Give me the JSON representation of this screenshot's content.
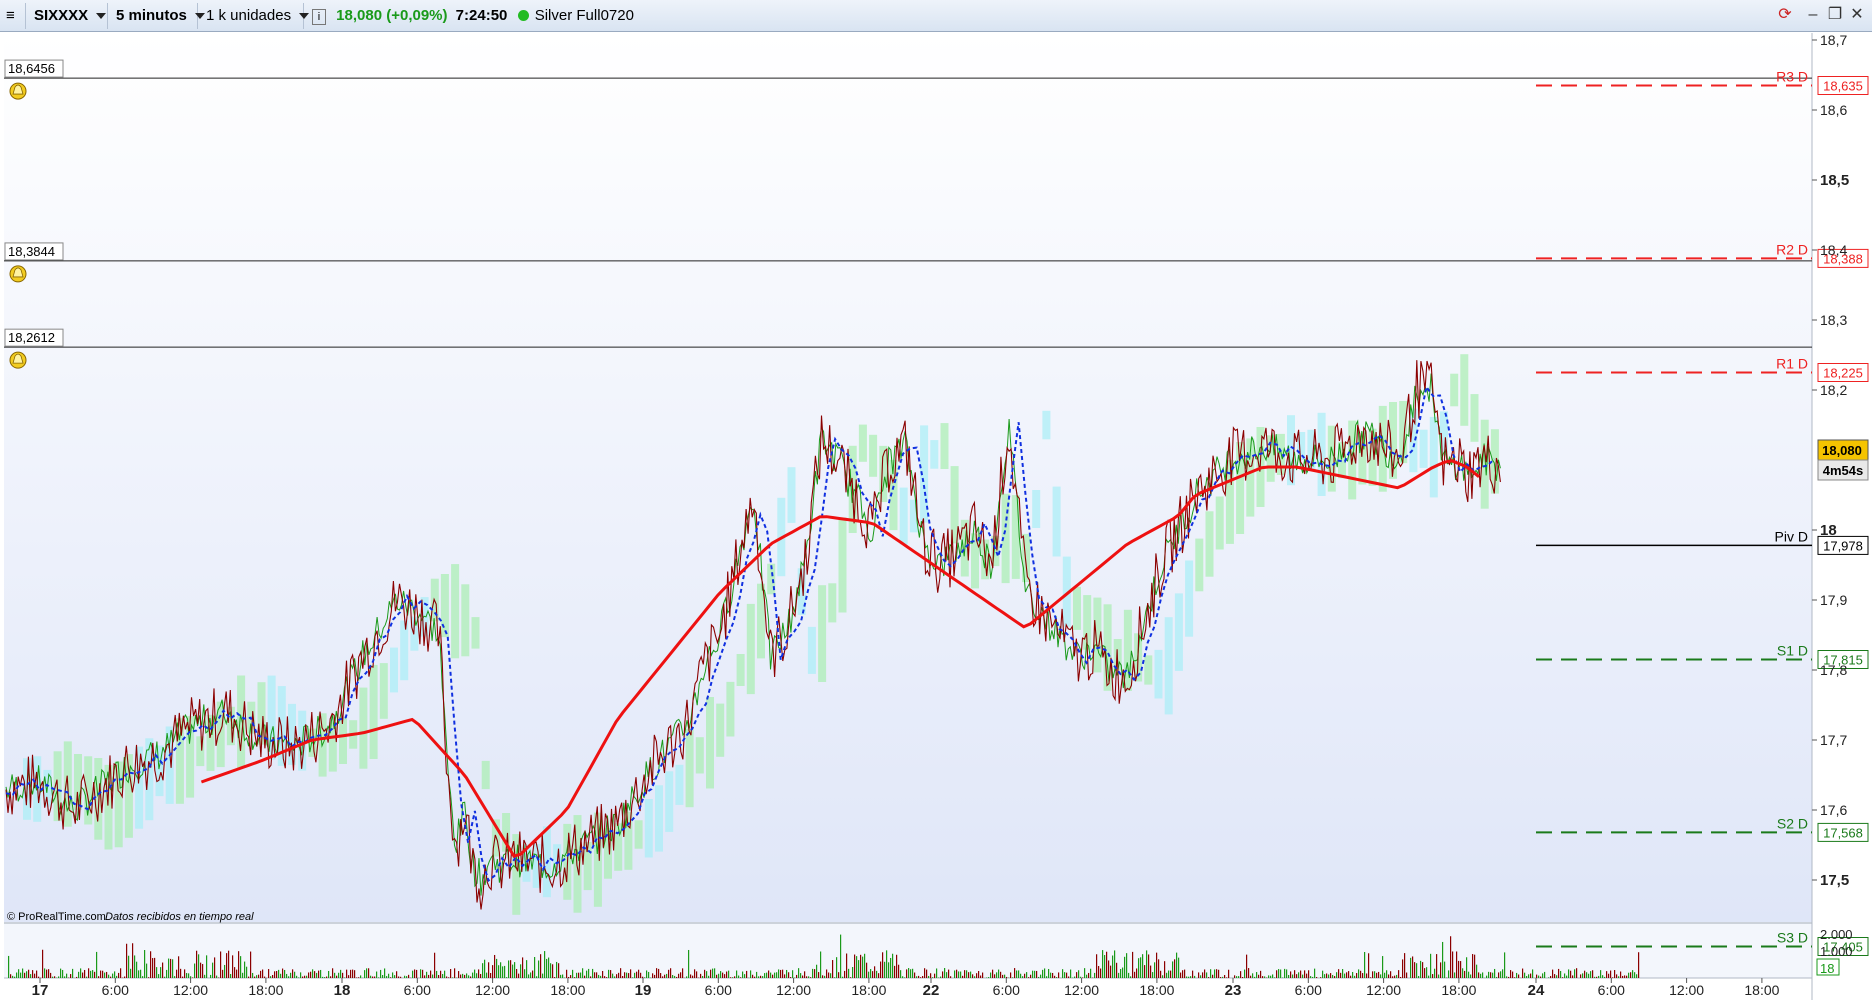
{
  "toolbar": {
    "symbol": "SIXXXX",
    "timeframe": "5 minutos",
    "units": "1 k unidades",
    "price_change": "18,080 (+0,09%)",
    "time": "7:24:50",
    "account": "Silver Full0720"
  },
  "countdown": "4m54s",
  "footer": {
    "copyright": "© ProRealTime.com",
    "status": "Datos recibidos en tiempo real"
  },
  "colors": {
    "up": "#1a9a1a",
    "down": "#8b0000",
    "ma": "#ee1111",
    "tenkan": "#1030e0",
    "resistance": "#ee2222",
    "support": "#1a7a1a",
    "cloud_green": "#a8eeb0",
    "cloud_cyan": "#a8eef6"
  },
  "chart_data": {
    "type": "line",
    "title": "",
    "y_axis": {
      "ticks": [
        "18,7",
        "18,6",
        "18,5",
        "18,4",
        "18,3",
        "18,2",
        "18",
        "17,9",
        "17,8",
        "17,7",
        "17,6",
        "17,5"
      ],
      "tick_values": [
        18.7,
        18.6,
        18.5,
        18.4,
        18.3,
        18.2,
        18.0,
        17.9,
        17.8,
        17.7,
        17.6,
        17.5
      ],
      "ylim": [
        17.44,
        18.71
      ]
    },
    "x_axis": {
      "ticks": [
        "17",
        "6:00",
        "12:00",
        "18:00",
        "18",
        "6:00",
        "12:00",
        "18:00",
        "19",
        "6:00",
        "12:00",
        "18:00",
        "22",
        "6:00",
        "12:00",
        "18:00",
        "23",
        "6:00",
        "12:00",
        "18:00",
        "24",
        "6:00",
        "12:00",
        "18:00"
      ],
      "day_labels": [
        "17",
        "18",
        "19",
        "22",
        "23",
        "24"
      ]
    },
    "price_tag": "18,080",
    "horizontal_lines": [
      {
        "label": "18,6456",
        "value": 18.6456
      },
      {
        "label": "18,3844",
        "value": 18.3844
      },
      {
        "label": "18,2612",
        "value": 18.2612
      }
    ],
    "pivots": [
      {
        "name": "R3 D",
        "label": "18,635",
        "value": 18.635,
        "kind": "resistance"
      },
      {
        "name": "R2 D",
        "label": "18,388",
        "value": 18.388,
        "kind": "resistance"
      },
      {
        "name": "R1 D",
        "label": "18,225",
        "value": 18.225,
        "kind": "resistance"
      },
      {
        "name": "Piv D",
        "label": "17,978",
        "value": 17.978,
        "kind": "pivot"
      },
      {
        "name": "S1 D",
        "label": "17,815",
        "value": 17.815,
        "kind": "support"
      },
      {
        "name": "S2 D",
        "label": "17,568",
        "value": 17.568,
        "kind": "support"
      },
      {
        "name": "S3 D",
        "label": "17,405",
        "value": 17.405,
        "kind": "support"
      }
    ],
    "series": [
      {
        "x": [
          0,
          0.02,
          0.04,
          0.06,
          0.07,
          0.09,
          0.11,
          0.13,
          0.15,
          0.17,
          0.19,
          0.21,
          0.23,
          0.245,
          0.255,
          0.26,
          0.265,
          0.27,
          0.275,
          0.28,
          0.285,
          0.29,
          0.3,
          0.32,
          0.34,
          0.36,
          0.38,
          0.4,
          0.405,
          0.41,
          0.42,
          0.43,
          0.44,
          0.45,
          0.46,
          0.47,
          0.48,
          0.49,
          0.5,
          0.51,
          0.52,
          0.53,
          0.54,
          0.55,
          0.56,
          0.57,
          0.58,
          0.59,
          0.6,
          0.61,
          0.62,
          0.63,
          0.64,
          0.65,
          0.66,
          0.67,
          0.68,
          0.69,
          0.7,
          0.72,
          0.74,
          0.76,
          0.78,
          0.8,
          0.82,
          0.83,
          0.84,
          0.845,
          0.85,
          0.855,
          0.86,
          0.87,
          0.88
        ],
        "values": [
          17.63,
          17.64,
          17.6,
          17.64,
          17.66,
          17.68,
          17.72,
          17.74,
          17.7,
          17.69,
          17.72,
          17.82,
          17.9,
          17.88,
          17.85,
          17.65,
          17.55,
          17.6,
          17.52,
          17.5,
          17.53,
          17.52,
          17.53,
          17.52,
          17.55,
          17.58,
          17.66,
          17.72,
          17.75,
          17.8,
          17.85,
          17.95,
          18.05,
          17.82,
          17.86,
          17.95,
          18.13,
          18.1,
          18.05,
          18.0,
          18.1,
          18.12,
          17.98,
          17.95,
          17.97,
          18.0,
          17.95,
          18.15,
          17.92,
          17.88,
          17.85,
          17.82,
          17.83,
          17.8,
          17.79,
          17.87,
          17.95,
          18.0,
          18.05,
          18.1,
          18.12,
          18.1,
          18.1,
          18.14,
          18.1,
          18.2,
          18.2,
          18.1,
          18.09,
          18.1,
          18.08,
          18.1,
          18.09
        ]
      },
      {
        "x": [
          0.115,
          0.15,
          0.18,
          0.21,
          0.24,
          0.27,
          0.3,
          0.33,
          0.36,
          0.39,
          0.42,
          0.45,
          0.48,
          0.51,
          0.54,
          0.57,
          0.6,
          0.63,
          0.66,
          0.69,
          0.7,
          0.72,
          0.74,
          0.76,
          0.78,
          0.8,
          0.82,
          0.84,
          0.85,
          0.86,
          0.87
        ],
        "values": [
          17.64,
          17.67,
          17.7,
          17.71,
          17.73,
          17.65,
          17.53,
          17.6,
          17.73,
          17.82,
          17.91,
          17.98,
          18.02,
          18.01,
          17.96,
          17.91,
          17.86,
          17.92,
          17.98,
          18.02,
          18.05,
          18.07,
          18.09,
          18.09,
          18.08,
          18.07,
          18.06,
          18.09,
          18.1,
          18.09,
          18.07
        ]
      }
    ],
    "volume_axis": [
      "2.000",
      "1.000",
      "18"
    ]
  }
}
